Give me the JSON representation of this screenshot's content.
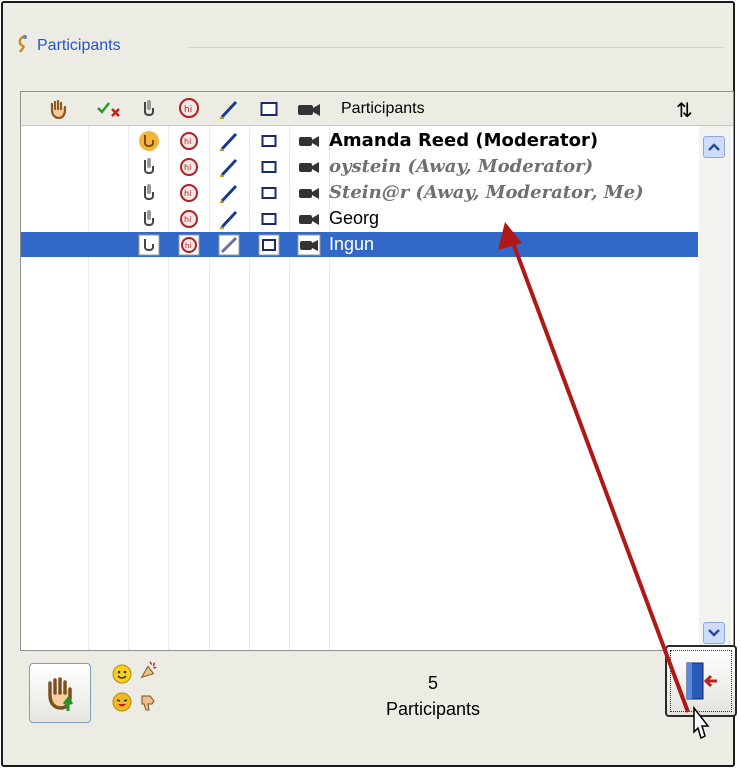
{
  "panel": {
    "title": "Participants",
    "title_icon": "participants-icon"
  },
  "list": {
    "columns": [
      {
        "icon": "raise-hand-icon"
      },
      {
        "icon": "approve-deny-icon"
      },
      {
        "icon": "microphone-icon"
      },
      {
        "icon": "chat-icon"
      },
      {
        "icon": "whiteboard-pen-icon"
      },
      {
        "icon": "screen-icon"
      },
      {
        "icon": "camera-icon"
      },
      {
        "label": "Participants"
      }
    ],
    "sort_icon": "sort-arrows-icon",
    "rows": [
      {
        "name": "Amanda Reed (Moderator)",
        "style": "bold",
        "mic_active": true,
        "selected": false
      },
      {
        "name": "oystein (Away, Moderator)",
        "style": "italic",
        "mic_active": false,
        "selected": false
      },
      {
        "name": "Stein@r (Away, Moderator, Me)",
        "style": "italic",
        "mic_active": false,
        "selected": false
      },
      {
        "name": "Georg",
        "style": "plain",
        "mic_active": false,
        "selected": false
      },
      {
        "name": "Ingun",
        "style": "plain",
        "mic_active": false,
        "selected": true
      }
    ]
  },
  "footer": {
    "count": "5",
    "count_label": "Participants",
    "raise_hand_button": "raise-hand-button",
    "emoticons": [
      "smile-icon",
      "applause-icon",
      "laugh-icon",
      "thumbs-down-icon"
    ],
    "exit_button": "exit-room-button"
  },
  "colors": {
    "selection": "#3268c7",
    "title": "#2356c7",
    "annotation_arrow": "#b01818"
  }
}
